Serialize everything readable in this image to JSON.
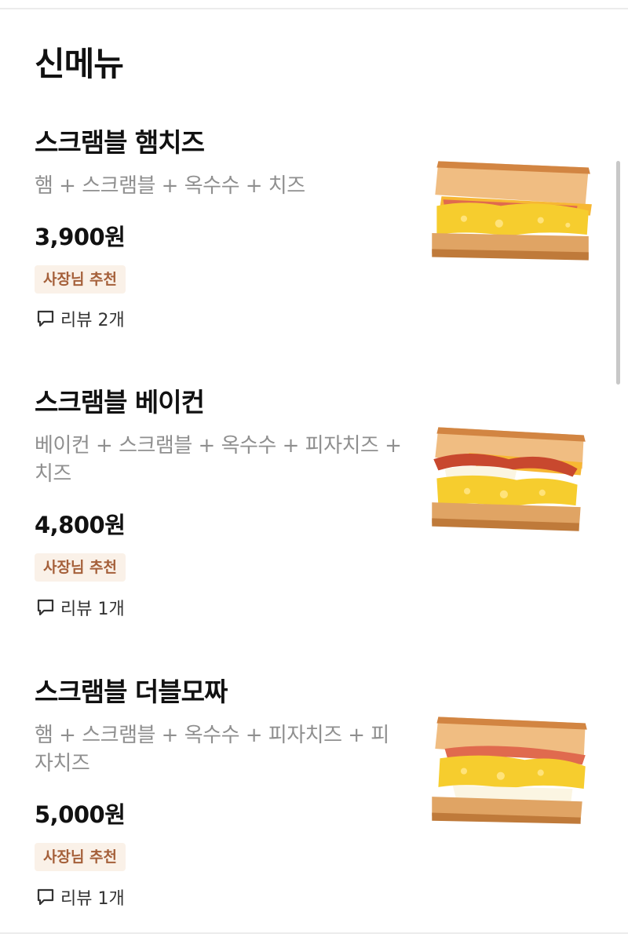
{
  "section": {
    "title": "신메뉴"
  },
  "menu_items": [
    {
      "name": "스크램블 햄치즈",
      "description": "햄 + 스크램블 + 옥수수 + 치즈",
      "price": "3,900원",
      "badge": "사장님 추천",
      "review": "리뷰 2개",
      "image_icon": "sandwich-ham-cheese"
    },
    {
      "name": "스크램블 베이컨",
      "description": "베이컨 + 스크램블 + 옥수수 + 피자치즈 + 치즈",
      "price": "4,800원",
      "badge": "사장님 추천",
      "review": "리뷰 1개",
      "image_icon": "sandwich-bacon"
    },
    {
      "name": "스크램블 더블모짜",
      "description": "햄 + 스크램블 + 옥수수 + 피자치즈 + 피자치즈",
      "price": "5,000원",
      "badge": "사장님 추천",
      "review": "리뷰 1개",
      "image_icon": "sandwich-double-mozza"
    }
  ],
  "colors": {
    "badge_bg": "#faf1e8",
    "badge_text": "#a5603a",
    "description_text": "#8f8f8f",
    "bread": "#e0a464",
    "egg": "#f6cd2e",
    "ham": "#e06a4e",
    "bacon": "#c8482e",
    "cheese": "#f7b733",
    "mozzarella": "#fbf5e2"
  }
}
